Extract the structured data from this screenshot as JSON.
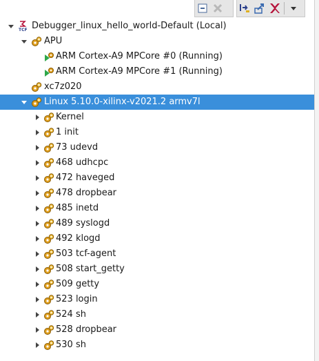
{
  "toolbar": {
    "buttons": [
      {
        "name": "collapse-all-button"
      },
      {
        "name": "remove-all-button"
      },
      {
        "name": "step-into-button"
      },
      {
        "name": "step-return-button"
      },
      {
        "name": "xilinx-button"
      },
      {
        "name": "view-menu-button"
      }
    ]
  },
  "tree": {
    "root": {
      "label": "Debugger_linux_hello_world-Default (Local)",
      "icon": "tcf-icon"
    },
    "apu": {
      "label": "APU"
    },
    "cores": [
      {
        "label": "ARM Cortex-A9 MPCore #0 (Running)"
      },
      {
        "label": "ARM Cortex-A9 MPCore #1 (Running)"
      }
    ],
    "target": {
      "label": "xc7z020"
    },
    "linux": {
      "label": "Linux 5.10.0-xilinx-v2021.2 armv7l"
    },
    "processes": [
      {
        "label": "Kernel"
      },
      {
        "label": "1 init"
      },
      {
        "label": "73 udevd"
      },
      {
        "label": "468 udhcpc"
      },
      {
        "label": "472 haveged"
      },
      {
        "label": "478 dropbear"
      },
      {
        "label": "485 inetd"
      },
      {
        "label": "489 syslogd"
      },
      {
        "label": "492 klogd"
      },
      {
        "label": "503 tcf-agent"
      },
      {
        "label": "508 start_getty"
      },
      {
        "label": "509 getty"
      },
      {
        "label": "523 login"
      },
      {
        "label": "524 sh"
      },
      {
        "label": "528 dropbear"
      },
      {
        "label": "530 sh"
      }
    ]
  },
  "colors": {
    "selection": "#3a8fdb",
    "gear": "#e0a020",
    "run": "#2fa84a",
    "xilinx": "#b5123a"
  }
}
